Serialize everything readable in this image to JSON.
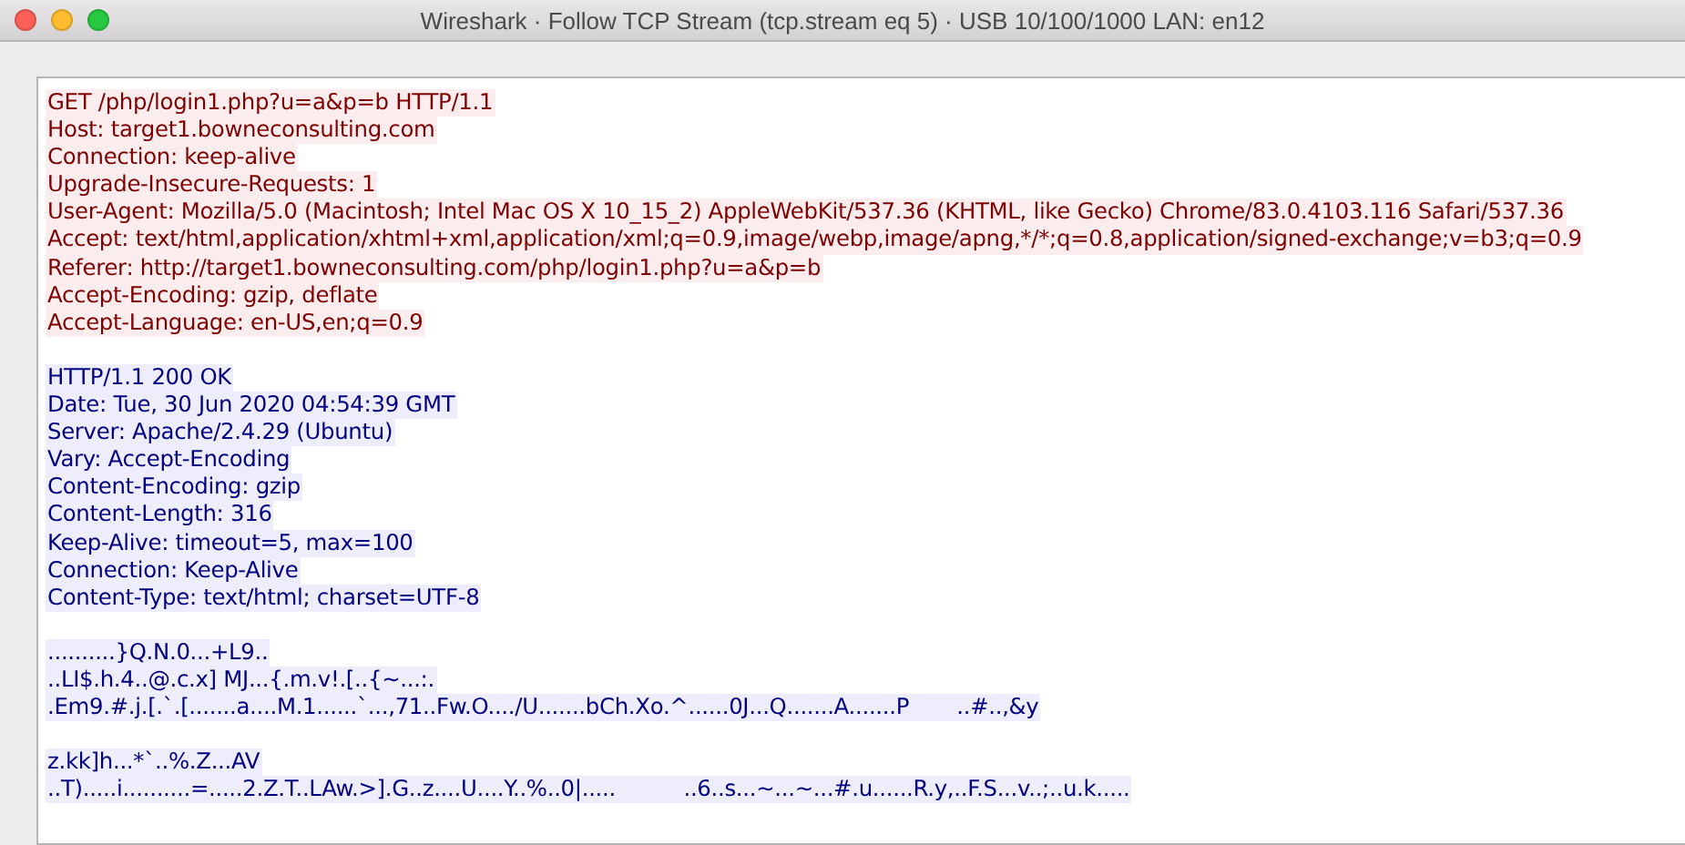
{
  "window": {
    "title": "Wireshark · Follow TCP Stream (tcp.stream eq 5) · USB 10/100/1000 LAN: en12"
  },
  "stream": {
    "segments": [
      {
        "kind": "client",
        "lines": [
          "GET /php/login1.php?u=a&p=b HTTP/1.1",
          "Host: target1.bowneconsulting.com",
          "Connection: keep-alive",
          "Upgrade-Insecure-Requests: 1",
          "User-Agent: Mozilla/5.0 (Macintosh; Intel Mac OS X 10_15_2) AppleWebKit/537.36 (KHTML, like Gecko) Chrome/83.0.4103.116 Safari/537.36",
          "Accept: text/html,application/xhtml+xml,application/xml;q=0.9,image/webp,image/apng,*/*;q=0.8,application/signed-exchange;v=b3;q=0.9",
          "Referer: http://target1.bowneconsulting.com/php/login1.php?u=a&p=b",
          "Accept-Encoding: gzip, deflate",
          "Accept-Language: en-US,en;q=0.9"
        ]
      },
      {
        "kind": "server",
        "lines": [
          "HTTP/1.1 200 OK",
          "Date: Tue, 30 Jun 2020 04:54:39 GMT",
          "Server: Apache/2.4.29 (Ubuntu)",
          "Vary: Accept-Encoding",
          "Content-Encoding: gzip",
          "Content-Length: 316",
          "Keep-Alive: timeout=5, max=100",
          "Connection: Keep-Alive",
          "Content-Type: text/html; charset=UTF-8"
        ]
      },
      {
        "kind": "server",
        "lines": [
          "..........}Q.N.0...+L9..",
          "..LI$.h.4..@.c.x] MJ...{.m.v!.[..{~...:.",
          ".Em9.#.j.[.`.[.......a....M.1......`...,71..Fw.O..../U.......bCh.Xo.^......0J...Q.......A.......P       ..#..,&y"
        ]
      },
      {
        "kind": "server",
        "lines": [
          "z.kk]h...*`..%.Z...AV",
          "..T).....i..........=.....2.Z.T..LAw.>].G..z....U....Y..%..0|.....          ..6..s...~...~...#.u......R.y,..F.S...v..;..u.k....."
        ]
      }
    ]
  }
}
